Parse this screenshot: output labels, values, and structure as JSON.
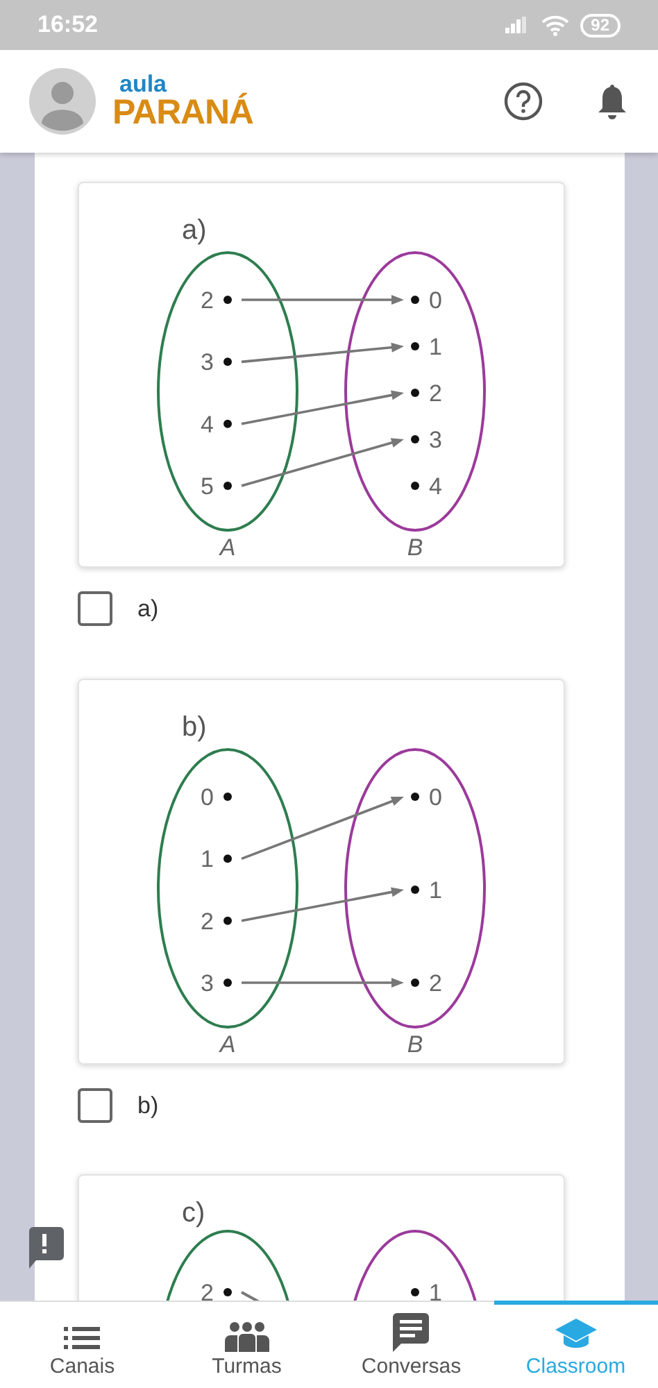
{
  "status_bar": {
    "time": "16:52",
    "battery": "92"
  },
  "header": {
    "logo_top": "aula",
    "logo_bottom": "PARANÁ"
  },
  "questions": [
    {
      "label": "a)",
      "set_a": [
        {
          "label": "2",
          "arrow_out": true
        },
        {
          "label": "3",
          "arrow_out": true
        },
        {
          "label": "4",
          "arrow_out": true
        },
        {
          "label": "5",
          "arrow_out": true
        }
      ],
      "set_b": [
        {
          "label": "0",
          "arrow_in": true
        },
        {
          "label": "1",
          "arrow_in": true
        },
        {
          "label": "2",
          "arrow_in": true
        },
        {
          "label": "3",
          "arrow_in": true
        },
        {
          "label": "4",
          "arrow_in": false
        }
      ],
      "name_a": "A",
      "name_b": "B",
      "option": {
        "label": "a)",
        "checked": false
      }
    },
    {
      "label": "b)",
      "set_a": [
        {
          "label": "0",
          "arrow_out": false
        },
        {
          "label": "1",
          "arrow_out": true
        },
        {
          "label": "2",
          "arrow_out": true
        },
        {
          "label": "3",
          "arrow_out": true
        }
      ],
      "set_b": [
        {
          "label": "0",
          "arrow_in": true
        },
        {
          "label": "1",
          "arrow_in": true
        },
        {
          "label": "2",
          "arrow_in": true
        }
      ],
      "name_a": "A",
      "name_b": "B",
      "option": {
        "label": "b)",
        "checked": false
      }
    },
    {
      "label": "c)",
      "set_a": [
        {
          "label": "2",
          "arrow_out": true
        }
      ],
      "set_b": [
        {
          "label": "1",
          "arrow_in": false
        }
      ]
    }
  ],
  "bottom_nav": [
    {
      "label": "Canais",
      "kind": "list",
      "selected": false
    },
    {
      "label": "Turmas",
      "kind": "group",
      "selected": false
    },
    {
      "label": "Conversas",
      "kind": "chat",
      "selected": false
    },
    {
      "label": "Classroom",
      "kind": "school",
      "selected": true
    }
  ]
}
